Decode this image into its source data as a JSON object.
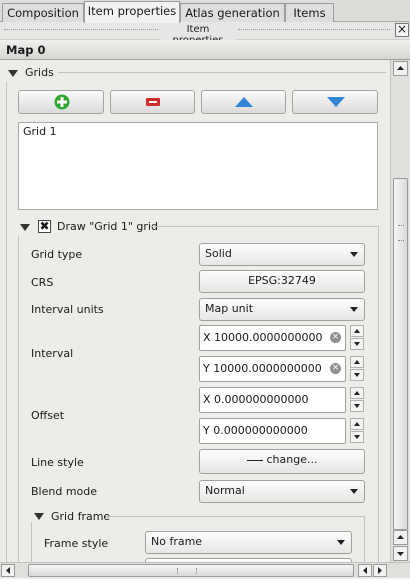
{
  "tabs": [
    {
      "label": "Composition"
    },
    {
      "label": "Item properties"
    },
    {
      "label": "Atlas generation"
    },
    {
      "label": "Items"
    }
  ],
  "dock": {
    "title": "Item properties",
    "close": "×"
  },
  "map_title": "Map 0",
  "grids": {
    "section_label": "Grids",
    "list_items": [
      "Grid 1"
    ],
    "draw_label": "Draw \"Grid 1\" grid",
    "draw_checked": true,
    "grid_type": {
      "label": "Grid type",
      "value": "Solid"
    },
    "crs": {
      "label": "CRS",
      "value": "EPSG:32749"
    },
    "interval_units": {
      "label": "Interval units",
      "value": "Map unit"
    },
    "interval": {
      "label": "Interval",
      "x": "X 10000.0000000000",
      "y": "Y 10000.0000000000"
    },
    "offset": {
      "label": "Offset",
      "x": "X 0.000000000000",
      "y": "Y 0.000000000000"
    },
    "line_style": {
      "label": "Line style",
      "value": "change..."
    },
    "blend_mode": {
      "label": "Blend mode",
      "value": "Normal"
    },
    "grid_frame": {
      "label": "Grid frame",
      "frame_style_label": "Frame style",
      "frame_style_value": "No frame"
    }
  },
  "colors": {
    "add": "#2fa62f",
    "remove": "#d42c2c",
    "arrows": "#2f86d6"
  }
}
